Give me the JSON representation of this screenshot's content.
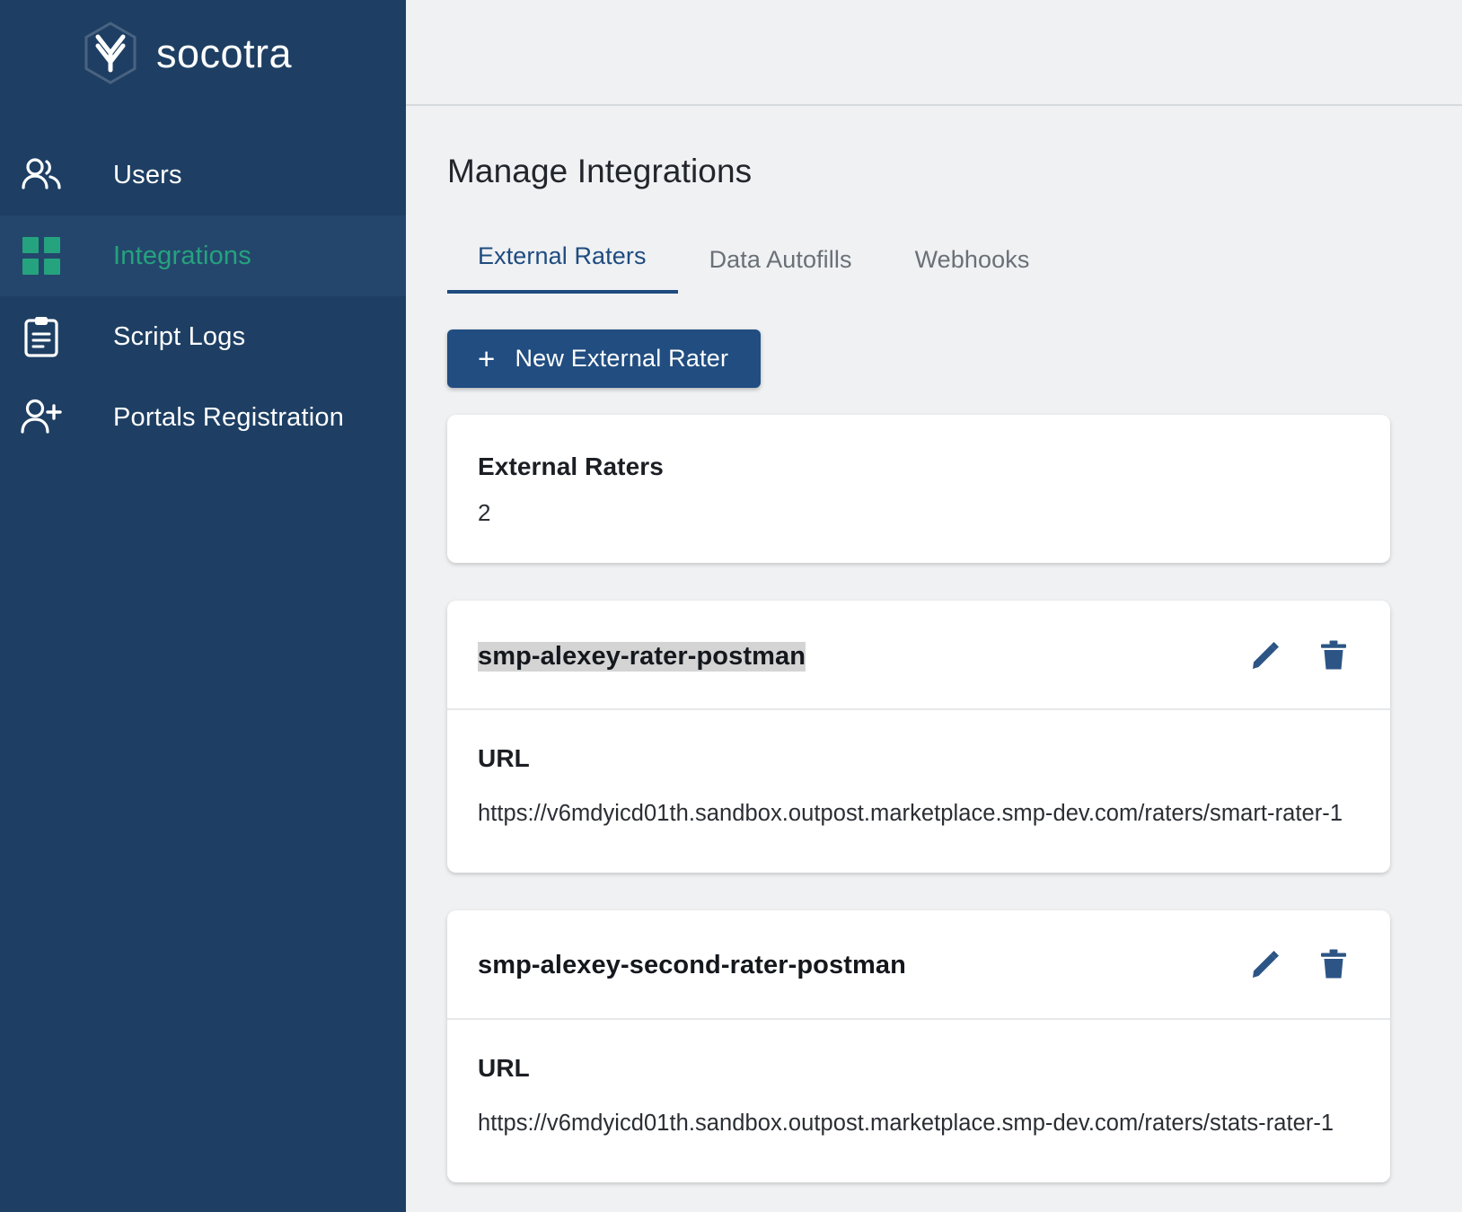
{
  "brand": {
    "name": "socotra",
    "logo_icon": "socotra-hexagon-logo"
  },
  "sidebar": {
    "items": [
      {
        "label": "Users",
        "icon": "users-icon",
        "active": false
      },
      {
        "label": "Integrations",
        "icon": "grid-squares-icon",
        "active": true
      },
      {
        "label": "Script Logs",
        "icon": "clipboard-icon",
        "active": false
      },
      {
        "label": "Portals Registration",
        "icon": "user-plus-icon",
        "active": false
      }
    ],
    "background_color": "#1e3f63",
    "active_color": "#25a37e"
  },
  "main": {
    "page_title": "Manage Integrations",
    "tabs": [
      {
        "label": "External Raters",
        "active": true
      },
      {
        "label": "Data Autofills",
        "active": false
      },
      {
        "label": "Webhooks",
        "active": false
      }
    ],
    "new_button": {
      "label": "New External Rater",
      "plus": "+",
      "color": "#214d80"
    },
    "summary": {
      "title": "External Raters",
      "count": "2"
    },
    "url_field_label": "URL",
    "raters": [
      {
        "name": "smp-alexey-rater-postman",
        "selected": true,
        "url_label": "URL",
        "url": "https://v6mdyicd01th.sandbox.outpost.marketplace.smp-dev.com/raters/smart-rater-1",
        "edit_icon": "pencil-icon",
        "delete_icon": "trash-icon"
      },
      {
        "name": "smp-alexey-second-rater-postman",
        "selected": false,
        "url_label": "URL",
        "url": "https://v6mdyicd01th.sandbox.outpost.marketplace.smp-dev.com/raters/stats-rater-1",
        "edit_icon": "pencil-icon",
        "delete_icon": "trash-icon"
      }
    ],
    "icon_color": "#2c5585",
    "background_color": "#eff1f3"
  }
}
